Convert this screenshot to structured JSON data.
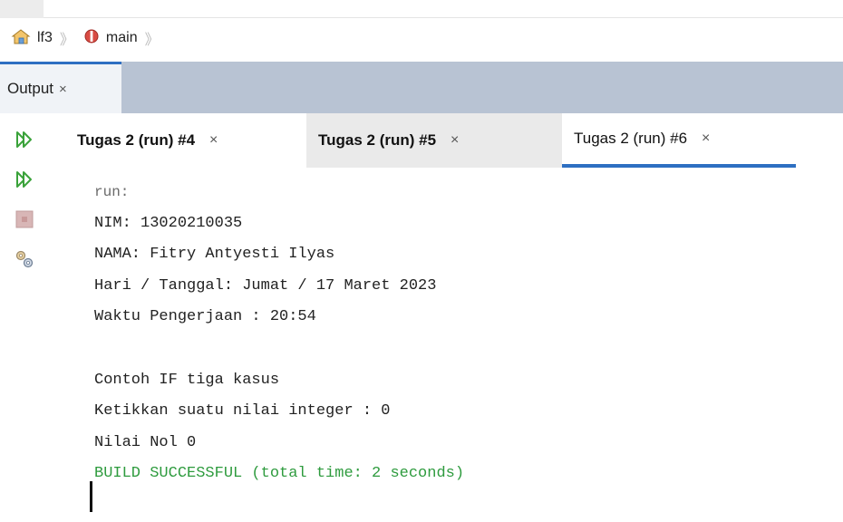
{
  "breadcrumb": {
    "items": [
      {
        "label": "lf3",
        "icon": "project-icon"
      },
      {
        "label": "main",
        "icon": "method-icon"
      }
    ],
    "separator": "》"
  },
  "output_panel": {
    "tab_label": "Output",
    "close_glyph": "×"
  },
  "run_tabs": [
    {
      "label": "Tugas 2 (run) #4",
      "close": "×",
      "active": false
    },
    {
      "label": "Tugas 2 (run) #5",
      "close": "×",
      "active": false
    },
    {
      "label": "Tugas 2 (run) #6",
      "close": "×",
      "active": true
    }
  ],
  "gutter_buttons": [
    {
      "name": "rerun-icon"
    },
    {
      "name": "rerun-with-options-icon"
    },
    {
      "name": "stop-icon"
    },
    {
      "name": "settings-icon"
    }
  ],
  "console": {
    "lines": [
      "run:",
      "NIM: 13020210035",
      "NAMA: Fitry Antyesti Ilyas",
      "Hari / Tanggal: Jumat / 17 Maret 2023",
      "Waktu Pengerjaan : 20:54",
      "",
      "Contoh IF tiga kasus",
      "Ketikkan suatu nilai integer : 0",
      "Nilai Nol 0",
      "BUILD SUCCESSFUL (total time: 2 seconds)"
    ]
  },
  "colors": {
    "accent": "#2e6fc2",
    "success": "#2e9b3e",
    "panel_bar": "#b8c3d3"
  }
}
